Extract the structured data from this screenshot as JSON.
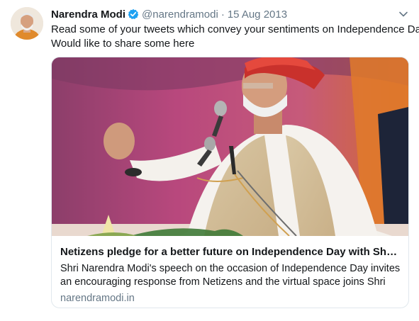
{
  "tweet": {
    "display_name": "Narendra Modi",
    "handle": "@narendramodi",
    "separator": "·",
    "date": "15 Aug 2013",
    "text_line1": "Read some of your tweets which convey your sentiments on Independence Day.",
    "text_line2": "Would like to share some here"
  },
  "card": {
    "title": "Netizens pledge for a better future on Independence Day with Shri M...",
    "description_line1": "Shri Narendra Modi's speech on the occasion of Independence Day invites",
    "description_line2": "an encouraging response from Netizens and the virtual space joins Shri",
    "domain": "narendramodi.in"
  },
  "icons": {
    "verified": "verified-badge-icon",
    "caret": "chevron-down-icon",
    "avatar": "profile-photo",
    "card_image": "speech-photo"
  },
  "colors": {
    "verified_blue": "#1da1f2",
    "secondary_text": "#657786",
    "card_border": "#e1e8ed"
  }
}
